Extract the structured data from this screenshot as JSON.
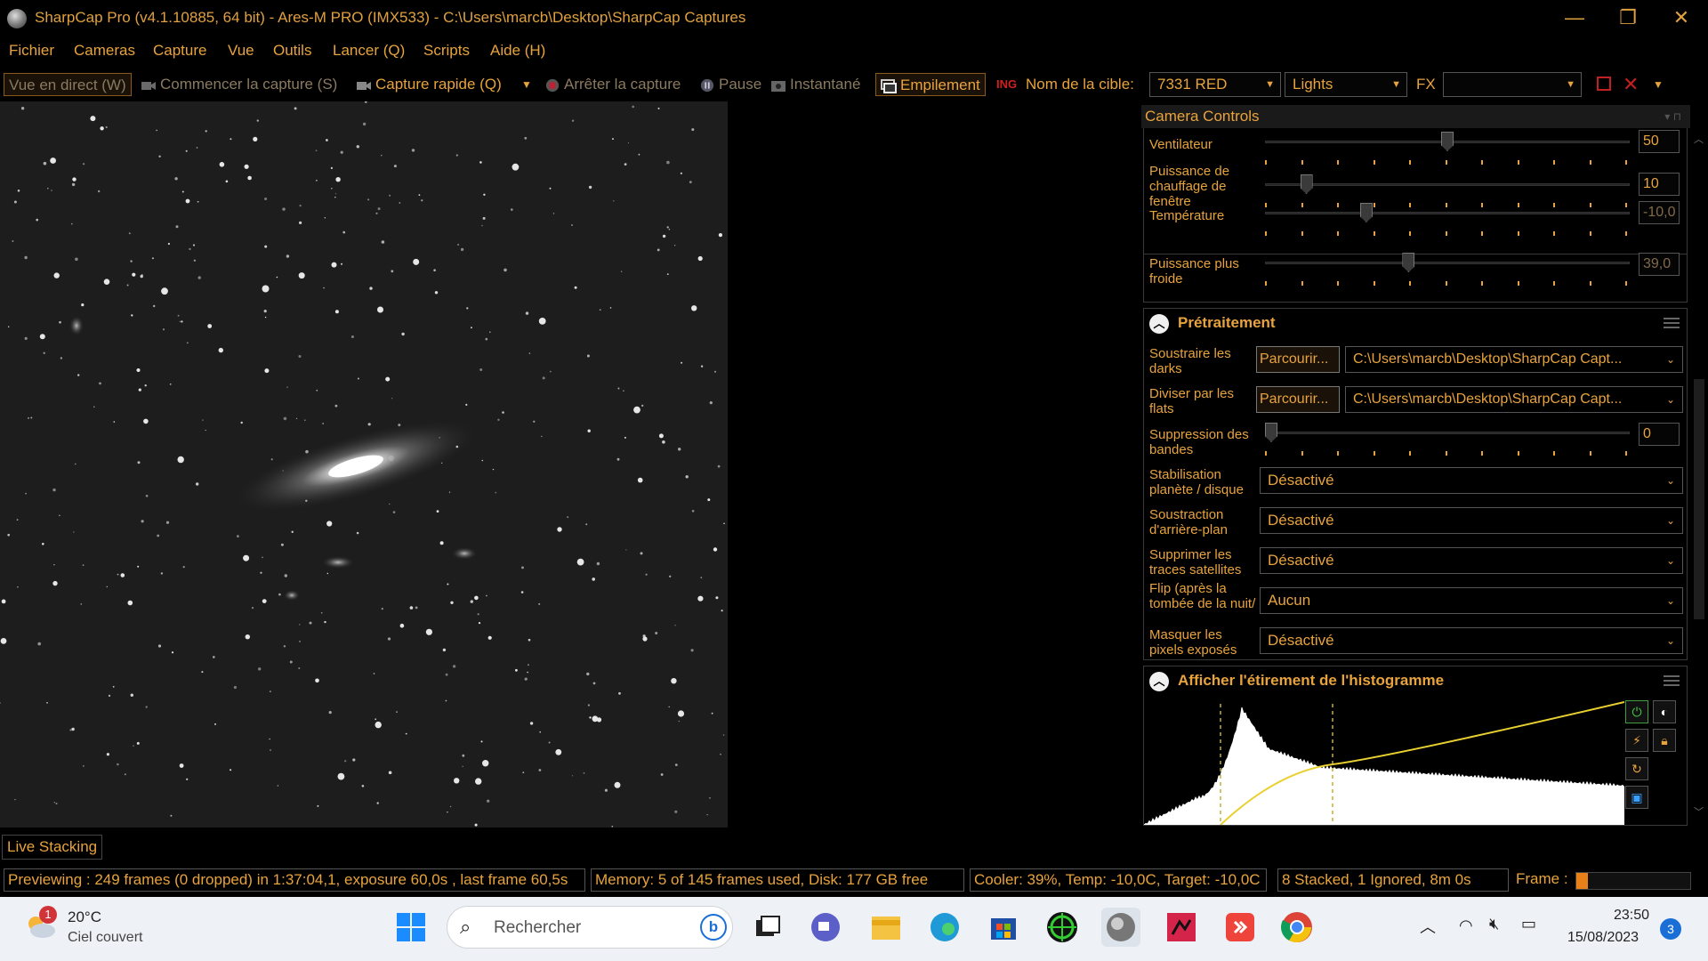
{
  "window": {
    "title": "SharpCap Pro (v4.1.10885, 64 bit) - Ares-M PRO (IMX533) - C:\\Users\\marcb\\Desktop\\SharpCap Captures",
    "minimize": "—",
    "maximize": "❐",
    "close": "✕"
  },
  "menu": [
    "Fichier",
    "Cameras",
    "Capture",
    "Vue",
    "Outils",
    "Lancer (Q)",
    "Scripts",
    "Aide (H)"
  ],
  "toolbar": {
    "live_view": "Vue en direct (W)",
    "start_capture": "Commencer la capture (S)",
    "quick_capture": "Capture rapide (Q)",
    "stop_capture": "Arrêter la capture",
    "pause": "Pause",
    "snapshot": "Instantané",
    "stacking": "Empilement",
    "target_label": "Nom de la cible:",
    "target_value": "7331 RED",
    "frame_type": "Lights",
    "fx_label": "FX",
    "fx_value": ""
  },
  "camera_controls": {
    "header": "Camera Controls",
    "rows": [
      {
        "label": "Ventilateur",
        "value": "50",
        "level": 0.5,
        "disabled": false
      },
      {
        "label": "Puissance de chauffage de fenêtre",
        "value": "10",
        "level": 0.1,
        "disabled": false
      },
      {
        "label": "Température",
        "value": "-10,0",
        "level": 0.27,
        "disabled": true
      },
      {
        "label": "Puissance plus froide",
        "value": "39,0",
        "level": 0.39,
        "disabled": true
      }
    ]
  },
  "preprocessing": {
    "title": "Prétraitement",
    "browse_label": "Parcourir...",
    "darks_label": "Soustraire les darks",
    "darks_path": "C:\\Users\\marcb\\Desktop\\SharpCap Capt...",
    "flats_label": "Diviser par les flats",
    "flats_path": "C:\\Users\\marcb\\Desktop\\SharpCap Capt...",
    "banding_label": "Suppression des bandes",
    "banding_value": "0",
    "banding_level": 0,
    "dropdowns": [
      {
        "label": "Stabilisation planète / disque",
        "value": "Désactivé"
      },
      {
        "label": "Soustraction d'arrière-plan",
        "value": "Désactivé"
      },
      {
        "label": "Supprimer les traces satellites",
        "value": "Désactivé"
      },
      {
        "label": "Flip (après la tombée de la nuit/à plat)",
        "value": "Aucun"
      },
      {
        "label": "Masquer les pixels exposés",
        "value": "Désactivé"
      }
    ]
  },
  "histogram": {
    "title": "Afficher l'étirement de l'histogramme"
  },
  "live_stacking_tab": "Live Stacking",
  "status": {
    "preview": "Previewing : 249 frames (0 dropped) in 1:37:04,1, exposure 60,0s , last frame 60,5s",
    "memory": "Memory: 5 of 145 frames used, Disk: 177 GB free",
    "cooler": "Cooler: 39%, Temp: -10,0C, Target: -10,0C",
    "stacked": "8 Stacked, 1 Ignored, 8m 0s",
    "frame_label": "Frame :",
    "frame_progress": 0.1
  },
  "taskbar": {
    "weather_temp": "20°C",
    "weather_desc": "Ciel couvert",
    "weather_badge": "1",
    "search_placeholder": "Rechercher",
    "time": "23:50",
    "date": "15/08/2023",
    "notif_count": "3"
  },
  "colors": {
    "accent": "#e8a33d",
    "background": "#000000",
    "taskbar": "#eef2f6"
  }
}
